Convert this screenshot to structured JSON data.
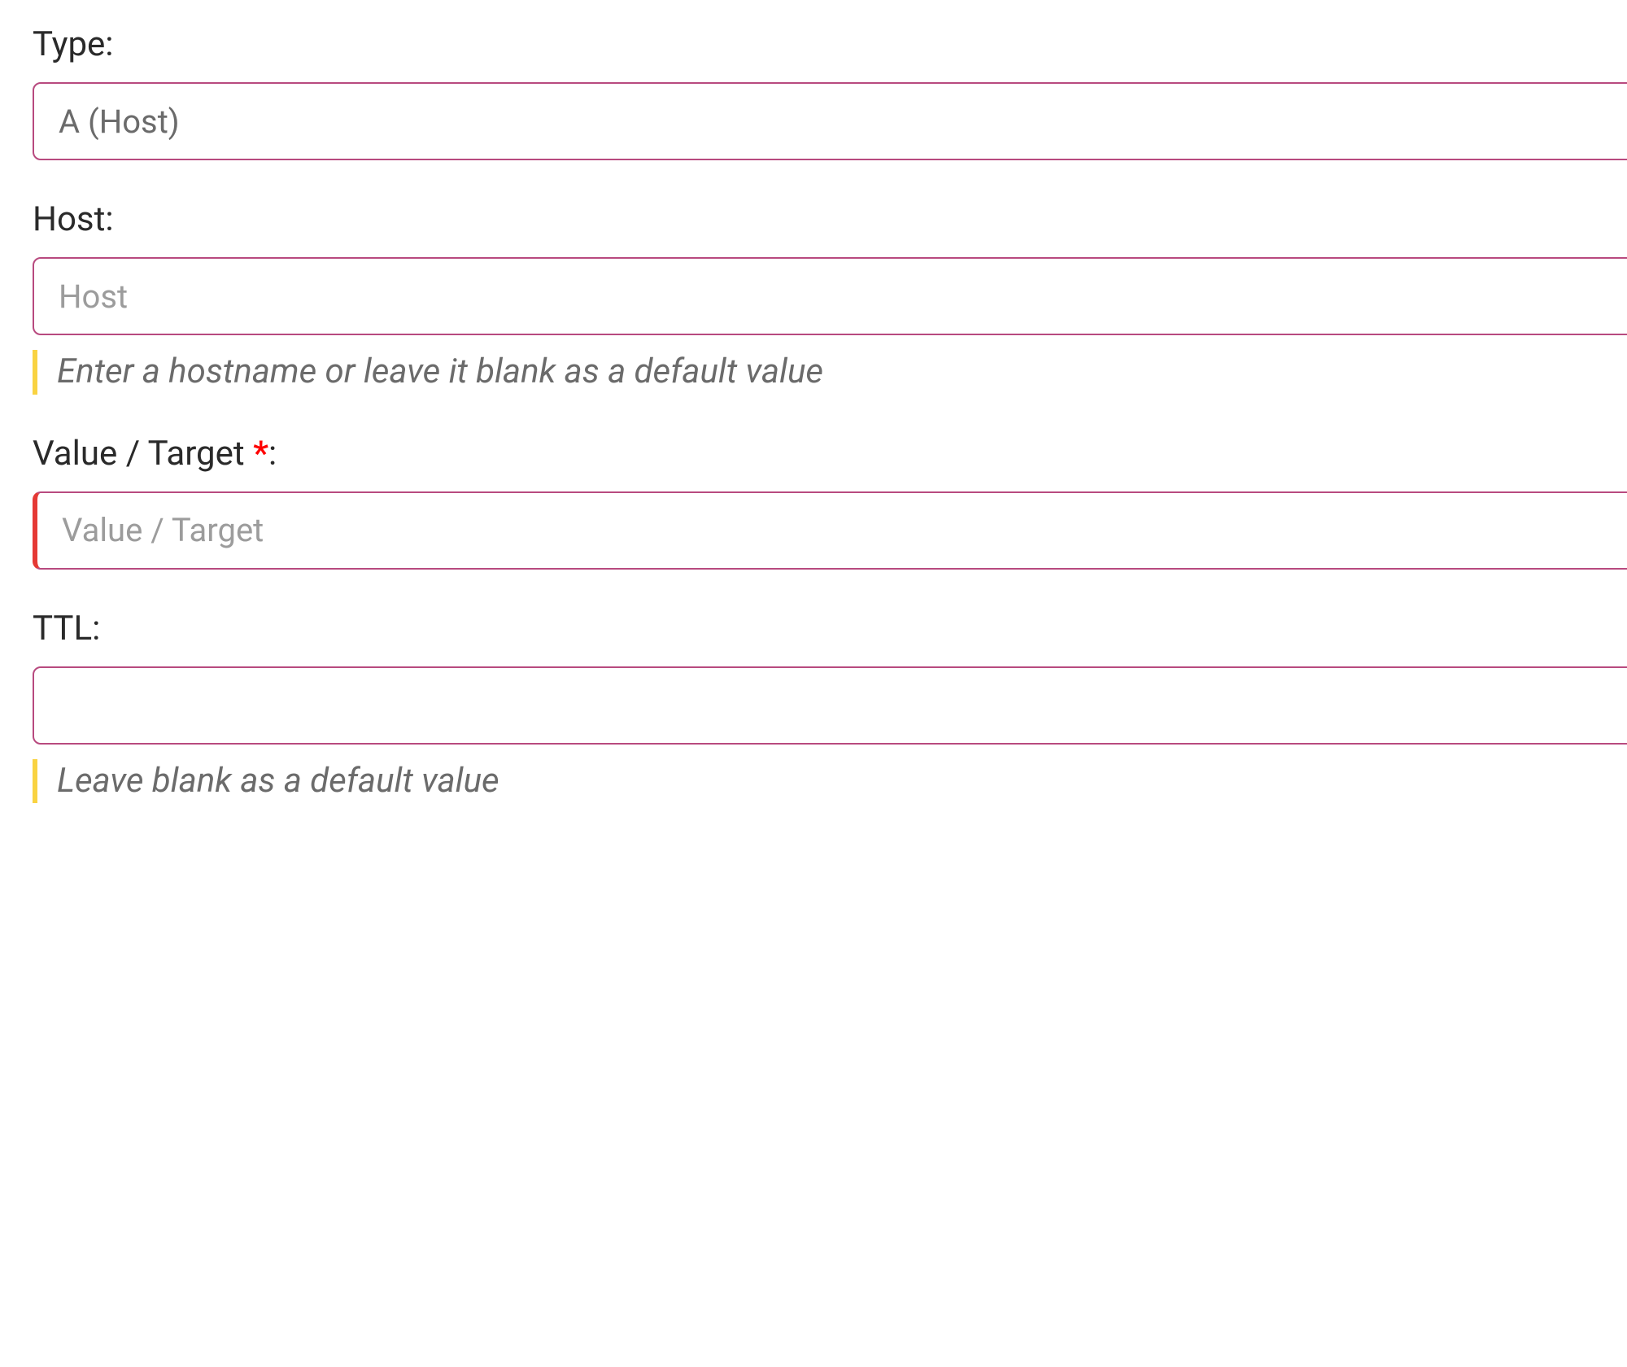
{
  "form": {
    "type": {
      "label": "Type:",
      "value": "A (Host)"
    },
    "host": {
      "label": "Host:",
      "placeholder": "Host",
      "hint": "Enter a hostname or leave it blank as a default value"
    },
    "value_target": {
      "label": "Value / Target ",
      "required_mark": "*",
      "label_suffix": ":",
      "placeholder": "Value / Target"
    },
    "ttl": {
      "label": "TTL:",
      "placeholder": "",
      "hint": "Leave blank as a default value"
    }
  }
}
